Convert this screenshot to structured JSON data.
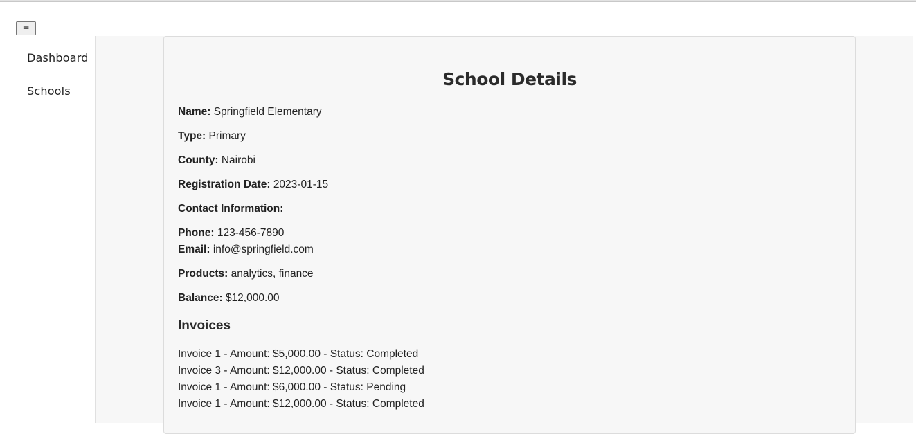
{
  "menu_toggle": {
    "label": "≡"
  },
  "sidebar": {
    "items": [
      {
        "label": "Dashboard"
      },
      {
        "label": "Schools"
      }
    ]
  },
  "school": {
    "title": "School Details",
    "name_label": "Name:",
    "name": "Springfield Elementary",
    "type_label": "Type:",
    "type": "Primary",
    "county_label": "County:",
    "county": "Nairobi",
    "registration_label": "Registration Date:",
    "registration_date": "2023-01-15",
    "contact_label": "Contact Information:",
    "phone_label": "Phone:",
    "phone": "123-456-7890",
    "email_label": "Email:",
    "email": "info@springfield.com",
    "products_label": "Products:",
    "products": "analytics, finance",
    "balance_label": "Balance:",
    "balance": "$12,000.00"
  },
  "invoices": {
    "title": "Invoices",
    "items": [
      "Invoice 1 - Amount: $5,000.00 - Status: Completed",
      "Invoice 3 - Amount: $12,000.00 - Status: Completed",
      "Invoice 1 - Amount: $6,000.00 - Status: Pending",
      "Invoice 1 - Amount: $12,000.00 - Status: Completed"
    ]
  }
}
